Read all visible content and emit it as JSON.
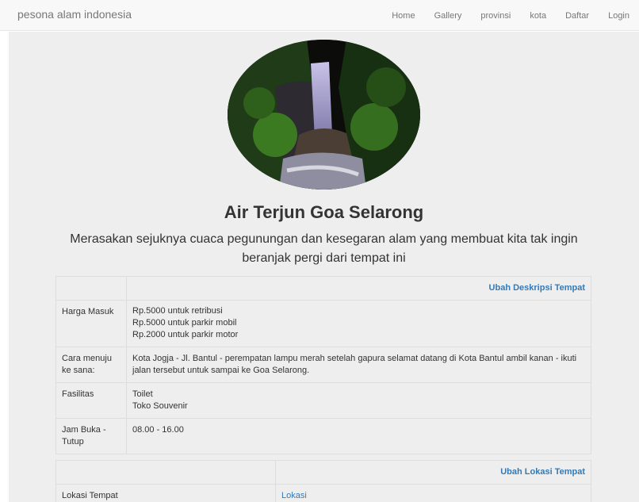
{
  "navbar": {
    "brand": "pesona alam indonesia",
    "items": [
      "Home",
      "Gallery",
      "provinsi",
      "kota",
      "Daftar",
      "Login"
    ]
  },
  "place": {
    "title": "Air Terjun Goa Selarong",
    "subtitle": "Merasakan sejuknya cuaca pegunungan dan kesegaran alam yang membuat kita tak ingin beranjak pergi dari tempat ini"
  },
  "description_table": {
    "edit_link": "Ubah Deskripsi Tempat",
    "rows": [
      {
        "label": "Harga Masuk",
        "lines": [
          "Rp.5000 untuk retribusi",
          "Rp.5000 untuk parkir mobil",
          "Rp.2000 untuk parkir motor"
        ]
      },
      {
        "label": "Cara menuju ke sana:",
        "lines": [
          "Kota Jogja - Jl. Bantul - perempatan lampu merah setelah gapura selamat datang di Kota Bantul ambil kanan - ikuti jalan tersebut untuk sampai ke Goa Selarong."
        ]
      },
      {
        "label": "Fasilitas",
        "lines": [
          "Toilet",
          "Toko Souvenir"
        ]
      },
      {
        "label": "Jam Buka - Tutup",
        "lines": [
          "08.00 - 16.00"
        ]
      }
    ]
  },
  "location_table": {
    "edit_link": "Ubah Lokasi Tempat",
    "label": "Lokasi Tempat",
    "link": "Lokasi"
  }
}
